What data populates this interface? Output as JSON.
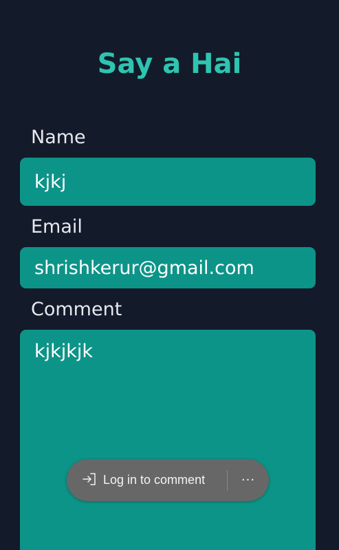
{
  "form": {
    "title": "Say a Hai",
    "name_label": "Name",
    "name_value": "kjkj",
    "email_label": "Email",
    "email_value": "shrishkerur@gmail.com",
    "comment_label": "Comment",
    "comment_value": "kjkjkjk"
  },
  "overlay": {
    "login_label": "Log in to comment",
    "login_icon": "sign-in-icon",
    "more_icon": "more-horizontal-icon",
    "more_glyph": "···"
  },
  "colors": {
    "background": "#131a29",
    "accent": "#2ec4b0",
    "field_bg": "#0d9488",
    "pill_bg": "#676767"
  }
}
